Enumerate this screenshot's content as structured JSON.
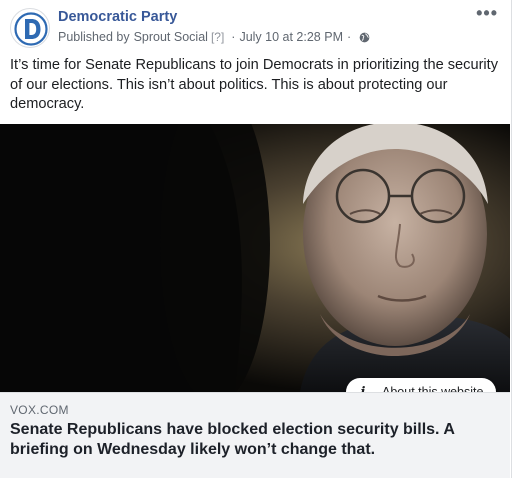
{
  "post": {
    "page_name": "Democratic Party",
    "published_prefix": "Published by",
    "publisher": "Sprout Social",
    "help_marker": "[?]",
    "separator": "·",
    "timestamp": "July 10 at 2:28 PM",
    "separator2": "·",
    "privacy_icon": "globe-icon",
    "more_icon": "•••",
    "text": "It’s time for Senate Republicans to join Democrats in prioritizing the security of our elections. This isn’t about politics. This is about protecting our democracy."
  },
  "link": {
    "about_icon": "i",
    "about_label": "About this website",
    "domain": "VOX.COM",
    "title": "Senate Republicans have blocked election security bills. A briefing on Wednesday likely won’t change that."
  },
  "colors": {
    "brand": "#385898",
    "party_blue": "#2e6ab3",
    "caption_bg": "#f2f3f5"
  }
}
